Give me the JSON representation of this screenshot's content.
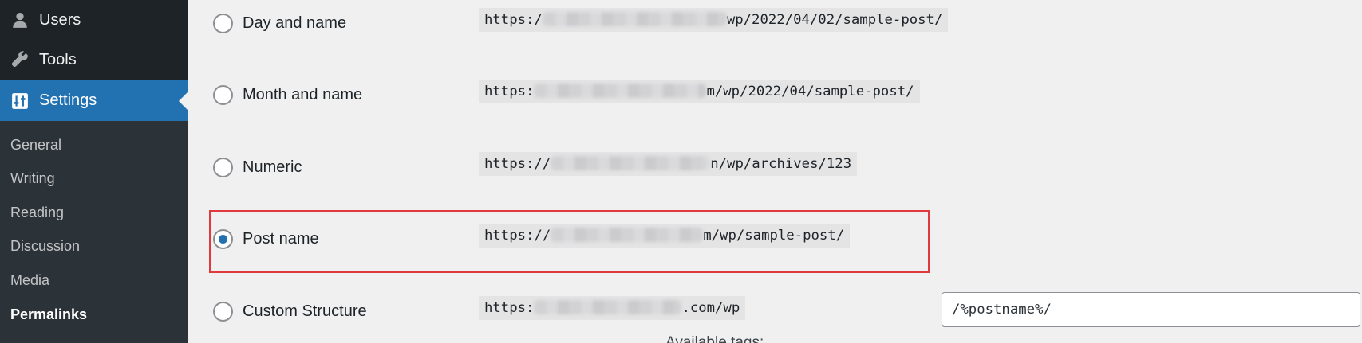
{
  "sidebar": {
    "menu": [
      {
        "label": "Users",
        "icon": "user-icon"
      },
      {
        "label": "Tools",
        "icon": "wrench-icon"
      },
      {
        "label": "Settings",
        "icon": "settings-icon",
        "active": true
      }
    ],
    "submenu": [
      {
        "label": "General"
      },
      {
        "label": "Writing"
      },
      {
        "label": "Reading"
      },
      {
        "label": "Discussion"
      },
      {
        "label": "Media"
      },
      {
        "label": "Permalinks",
        "current": true
      }
    ]
  },
  "permalink_options": [
    {
      "label": "Day and name",
      "url_prefix": "https:/",
      "url_suffix": "wp/2022/04/02/sample-post/",
      "checked": false
    },
    {
      "label": "Month and name",
      "url_prefix": "https:",
      "url_suffix": "m/wp/2022/04/sample-post/",
      "checked": false
    },
    {
      "label": "Numeric",
      "url_prefix": "https://",
      "url_suffix": "n/wp/archives/123",
      "checked": false
    },
    {
      "label": "Post name",
      "url_prefix": "https://",
      "url_suffix": "m/wp/sample-post/",
      "checked": true
    },
    {
      "label": "Custom Structure",
      "url_prefix": "https:",
      "url_suffix": ".com/wp",
      "checked": false
    }
  ],
  "custom_structure_value": "/%postname%/",
  "available_tags_label": "Available tags:",
  "colors": {
    "sidebar_bg": "#1d2327",
    "submenu_bg": "#2c3338",
    "accent": "#2271b1",
    "highlight_border": "#e0393e",
    "page_bg": "#f0f0f1"
  }
}
